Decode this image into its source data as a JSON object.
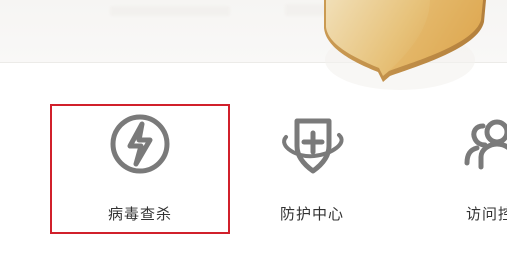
{
  "features": [
    {
      "label": "病毒查杀",
      "icon": "virus-scan-bolt-icon",
      "selected": true
    },
    {
      "label": "防护中心",
      "icon": "protection-shield-plus-icon",
      "selected": false
    },
    {
      "label": "访问控",
      "icon": "access-control-users-icon",
      "selected": false
    }
  ],
  "colors": {
    "accent": "#d1202b",
    "icon_gray": "#7a7a7a",
    "text": "#333333",
    "shield_gold_light": "#efd6a1",
    "shield_gold_dark": "#d8a24d"
  }
}
